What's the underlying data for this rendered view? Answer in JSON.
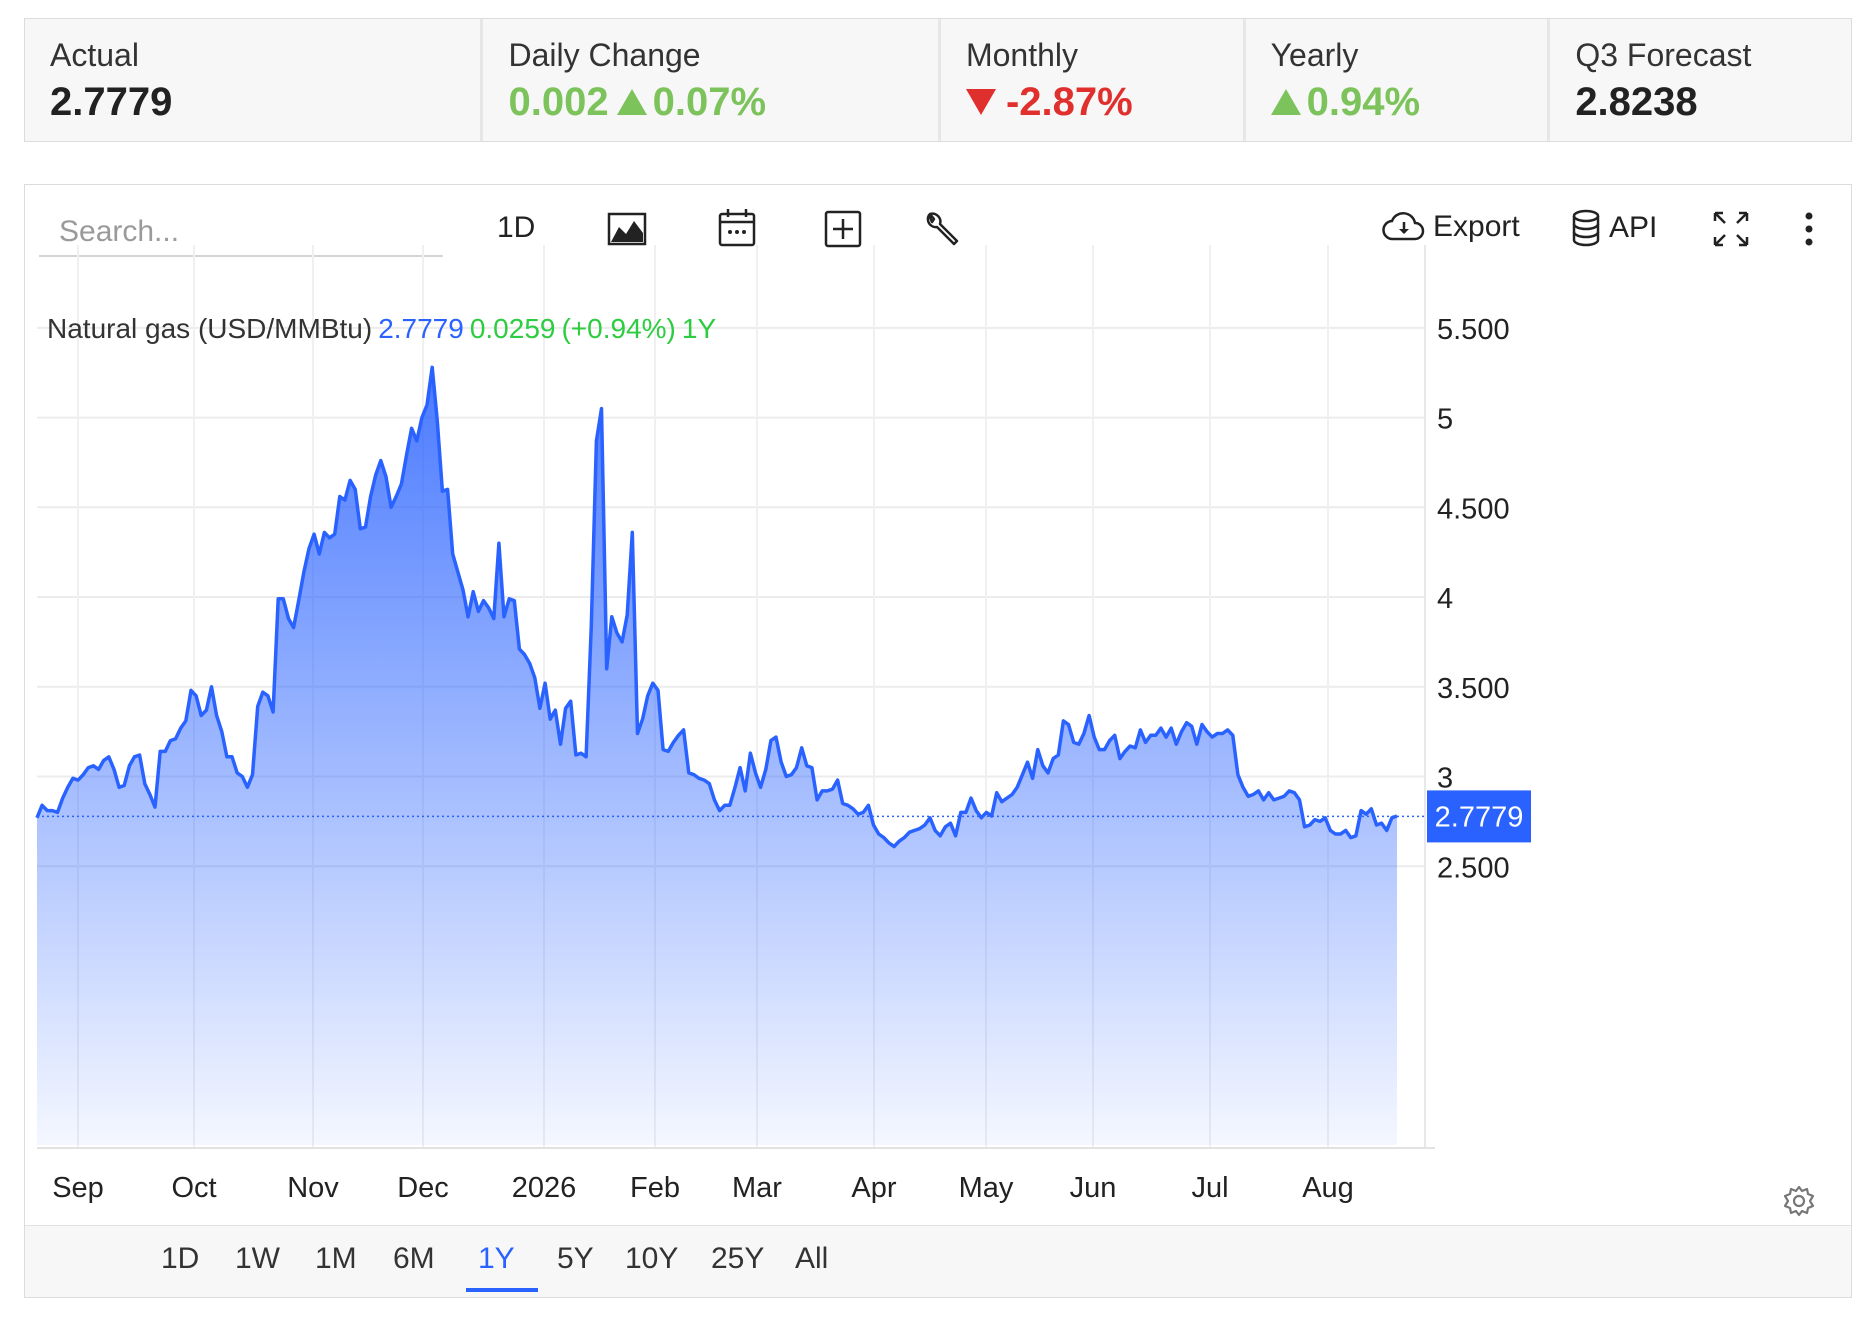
{
  "stats": [
    {
      "label": "Actual",
      "value": "2.7779"
    },
    {
      "label": "Daily Change",
      "value": "0.002",
      "percent": "0.07%"
    },
    {
      "label": "Monthly",
      "value": "-2.87%"
    },
    {
      "label": "Yearly",
      "value": "0.94%"
    },
    {
      "label": "Q3 Forecast",
      "value": "2.8238"
    }
  ],
  "toolbar": {
    "search_placeholder": "Search...",
    "interval": "1D",
    "export_label": "Export",
    "api_label": "API"
  },
  "legend": {
    "name": "Natural gas (USD/MMBtu)",
    "value": "2.7779",
    "change": "0.0259",
    "percent": "(+0.94%)",
    "period": "1Y"
  },
  "ranges": [
    "1D",
    "1W",
    "1M",
    "6M",
    "1Y",
    "5Y",
    "10Y",
    "25Y",
    "All"
  ],
  "active_range": "1Y",
  "colors": {
    "line": "#2962ff",
    "up": "#7cc35c",
    "down": "#e0302e",
    "legend_change": "#2ecc40"
  },
  "chart_data": {
    "type": "area",
    "series_name": "Natural gas (USD/MMBtu)",
    "x_labels": [
      "Sep",
      "Oct",
      "Nov",
      "Dec",
      "2026",
      "Feb",
      "Mar",
      "Apr",
      "May",
      "Jun",
      "Jul",
      "Aug"
    ],
    "y_ticks": [
      "5.500",
      "5",
      "4.500",
      "4",
      "3.500",
      "3",
      "2.500"
    ],
    "ylim": [
      1.95,
      5.85
    ],
    "current_value_label": "2.7779",
    "current_value": 2.7779,
    "grid": true,
    "values": [
      2.77,
      2.84,
      2.81,
      2.81,
      2.8,
      2.88,
      2.94,
      2.99,
      2.98,
      3.01,
      3.05,
      3.06,
      3.04,
      3.09,
      3.11,
      3.04,
      2.94,
      2.95,
      3.06,
      3.11,
      3.12,
      2.96,
      2.9,
      2.83,
      3.14,
      3.14,
      3.2,
      3.21,
      3.27,
      3.31,
      3.48,
      3.45,
      3.34,
      3.37,
      3.5,
      3.34,
      3.25,
      3.11,
      3.11,
      3.02,
      3.0,
      2.94,
      3.01,
      3.39,
      3.47,
      3.45,
      3.36,
      3.99,
      3.99,
      3.88,
      3.83,
      3.98,
      4.14,
      4.27,
      4.35,
      4.24,
      4.36,
      4.33,
      4.35,
      4.56,
      4.54,
      4.65,
      4.6,
      4.38,
      4.39,
      4.56,
      4.68,
      4.76,
      4.67,
      4.5,
      4.56,
      4.63,
      4.79,
      4.94,
      4.87,
      5.0,
      5.07,
      5.28,
      4.98,
      4.59,
      4.6,
      4.24,
      4.14,
      4.04,
      3.89,
      4.03,
      3.92,
      3.98,
      3.94,
      3.88,
      4.3,
      3.89,
      3.99,
      3.98,
      3.71,
      3.68,
      3.63,
      3.55,
      3.38,
      3.52,
      3.32,
      3.37,
      3.18,
      3.38,
      3.42,
      3.12,
      3.13,
      3.11,
      3.84,
      4.87,
      5.05,
      3.6,
      3.89,
      3.8,
      3.75,
      3.9,
      4.36,
      3.24,
      3.32,
      3.45,
      3.52,
      3.48,
      3.15,
      3.14,
      3.19,
      3.23,
      3.26,
      3.02,
      3.01,
      2.99,
      2.98,
      2.96,
      2.87,
      2.81,
      2.84,
      2.84,
      2.94,
      3.05,
      2.92,
      3.13,
      3.02,
      2.94,
      3.04,
      3.2,
      3.22,
      3.08,
      3.0,
      3.01,
      3.05,
      3.16,
      3.06,
      3.05,
      2.87,
      2.92,
      2.92,
      2.93,
      2.98,
      2.85,
      2.84,
      2.82,
      2.79,
      2.8,
      2.84,
      2.73,
      2.68,
      2.66,
      2.63,
      2.61,
      2.64,
      2.66,
      2.69,
      2.7,
      2.71,
      2.73,
      2.77,
      2.7,
      2.67,
      2.72,
      2.74,
      2.67,
      2.8,
      2.8,
      2.88,
      2.81,
      2.77,
      2.8,
      2.78,
      2.91,
      2.86,
      2.88,
      2.9,
      2.94,
      3.01,
      3.08,
      2.99,
      3.15,
      3.06,
      3.02,
      3.1,
      3.12,
      3.31,
      3.29,
      3.19,
      3.18,
      3.24,
      3.34,
      3.22,
      3.15,
      3.15,
      3.2,
      3.23,
      3.1,
      3.14,
      3.17,
      3.16,
      3.26,
      3.19,
      3.23,
      3.23,
      3.27,
      3.22,
      3.27,
      3.18,
      3.25,
      3.3,
      3.28,
      3.18,
      3.29,
      3.25,
      3.22,
      3.24,
      3.24,
      3.26,
      3.23,
      3.01,
      2.94,
      2.89,
      2.9,
      2.92,
      2.87,
      2.91,
      2.87,
      2.88,
      2.89,
      2.92,
      2.91,
      2.87,
      2.72,
      2.73,
      2.76,
      2.75,
      2.77,
      2.7,
      2.68,
      2.68,
      2.7,
      2.66,
      2.67,
      2.81,
      2.79,
      2.82,
      2.73,
      2.74,
      2.7,
      2.77,
      2.78
    ]
  }
}
